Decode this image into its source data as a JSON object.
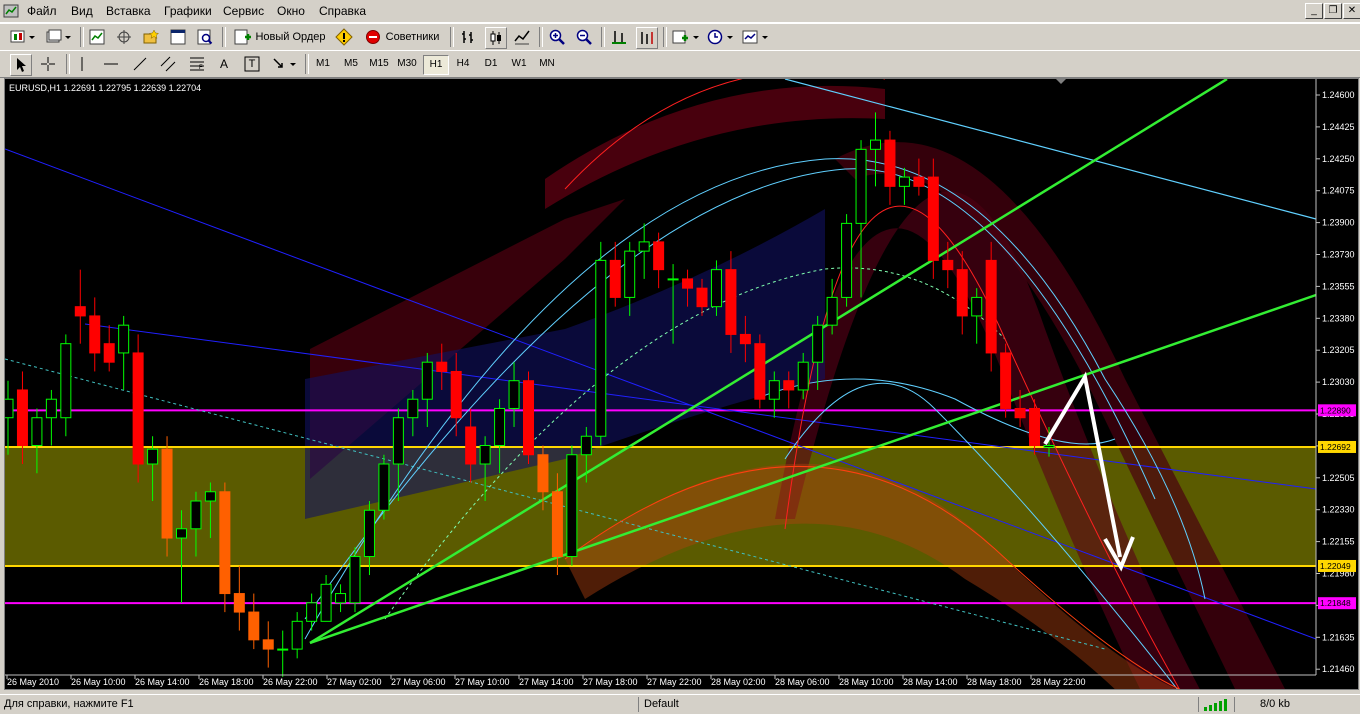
{
  "menu": [
    "Файл",
    "Вид",
    "Вставка",
    "Графики",
    "Сервис",
    "Окно",
    "Справка"
  ],
  "toolbar": {
    "new_order": "Новый Ордер",
    "advisors": "Советники",
    "labels": [
      "A",
      "T"
    ]
  },
  "timeframes": [
    {
      "label": "M1",
      "active": false
    },
    {
      "label": "M5",
      "active": false
    },
    {
      "label": "M15",
      "active": false
    },
    {
      "label": "M30",
      "active": false
    },
    {
      "label": "H1",
      "active": true
    },
    {
      "label": "H4",
      "active": false
    },
    {
      "label": "D1",
      "active": false
    },
    {
      "label": "W1",
      "active": false
    },
    {
      "label": "MN",
      "active": false
    }
  ],
  "chart": {
    "info": "EURUSD,H1  1.22691 1.22795 1.22639 1.22704",
    "price_axis": [
      "1.24600",
      "1.24425",
      "1.24250",
      "1.24075",
      "1.23900",
      "1.23730",
      "1.23555",
      "1.23380",
      "1.23205",
      "1.23030",
      "1.22855",
      "1.22680",
      "1.22505",
      "1.22330",
      "1.22155",
      "1.21980",
      "1.21805",
      "1.21635",
      "1.21460"
    ],
    "time_axis": [
      "26 May 2010",
      "26 May 10:00",
      "26 May 14:00",
      "26 May 18:00",
      "26 May 22:00",
      "27 May 02:00",
      "27 May 06:00",
      "27 May 10:00",
      "27 May 14:00",
      "27 May 18:00",
      "27 May 22:00",
      "28 May 02:00",
      "28 May 06:00",
      "28 May 10:00",
      "28 May 14:00",
      "28 May 18:00",
      "28 May 22:00"
    ],
    "levels": [
      {
        "price": 1.22692,
        "label": "1.22692",
        "color": "#ffd700"
      },
      {
        "price": 1.22049,
        "label": "1.22049",
        "color": "#ffd700"
      },
      {
        "price": 1.2289,
        "label": "1.22890",
        "color": "#ff00ff"
      },
      {
        "price": 1.21848,
        "label": "1.21848",
        "color": "#ff00ff"
      }
    ],
    "colors": {
      "bull": "#00ff00",
      "bear": "#ff0000",
      "bear_orange": "#ff6000",
      "grid": "#404040",
      "trend": "#33ee33",
      "zone": "#6b6b00"
    }
  },
  "chart_data": {
    "type": "candlestick",
    "symbol": "EURUSD",
    "timeframe": "H1",
    "ohlc_last": {
      "open": 1.22691,
      "high": 1.22795,
      "low": 1.22639,
      "close": 1.22704
    },
    "ylim": [
      1.2146,
      1.2468
    ],
    "candles": [
      [
        1.2285,
        1.2305,
        1.2265,
        1.2295
      ],
      [
        1.23,
        1.231,
        1.226,
        1.227
      ],
      [
        1.227,
        1.229,
        1.2255,
        1.2285
      ],
      [
        1.2285,
        1.23,
        1.227,
        1.2295
      ],
      [
        1.2285,
        1.233,
        1.2275,
        1.2325
      ],
      [
        1.2345,
        1.2365,
        1.2325,
        1.234
      ],
      [
        1.234,
        1.235,
        1.231,
        1.232
      ],
      [
        1.2325,
        1.2335,
        1.231,
        1.2315
      ],
      [
        1.232,
        1.234,
        1.23,
        1.2335
      ],
      [
        1.232,
        1.233,
        1.225,
        1.226
      ],
      [
        1.226,
        1.2275,
        1.224,
        1.2268
      ],
      [
        1.2268,
        1.2275,
        1.221,
        1.222
      ],
      [
        1.222,
        1.2235,
        1.2185,
        1.2225
      ],
      [
        1.2225,
        1.2245,
        1.221,
        1.224
      ],
      [
        1.224,
        1.225,
        1.222,
        1.2245
      ],
      [
        1.2245,
        1.225,
        1.218,
        1.219
      ],
      [
        1.219,
        1.2205,
        1.217,
        1.218
      ],
      [
        1.218,
        1.219,
        1.216,
        1.2165
      ],
      [
        1.2165,
        1.2175,
        1.215,
        1.216
      ],
      [
        1.216,
        1.217,
        1.2145,
        1.216
      ],
      [
        1.216,
        1.218,
        1.2155,
        1.2175
      ],
      [
        1.2175,
        1.219,
        1.217,
        1.2185
      ],
      [
        1.2175,
        1.22,
        1.2175,
        1.2195
      ],
      [
        1.2185,
        1.2195,
        1.218,
        1.219
      ],
      [
        1.2185,
        1.2215,
        1.218,
        1.221
      ],
      [
        1.221,
        1.224,
        1.22,
        1.2235
      ],
      [
        1.2235,
        1.2265,
        1.223,
        1.226
      ],
      [
        1.226,
        1.229,
        1.224,
        1.2285
      ],
      [
        1.2285,
        1.23,
        1.2275,
        1.2295
      ],
      [
        1.2295,
        1.232,
        1.228,
        1.2315
      ],
      [
        1.2315,
        1.2325,
        1.23,
        1.231
      ],
      [
        1.231,
        1.232,
        1.2275,
        1.2285
      ],
      [
        1.228,
        1.229,
        1.225,
        1.226
      ],
      [
        1.226,
        1.2275,
        1.224,
        1.227
      ],
      [
        1.227,
        1.2295,
        1.2255,
        1.229
      ],
      [
        1.229,
        1.2315,
        1.228,
        1.2305
      ],
      [
        1.2305,
        1.231,
        1.226,
        1.2265
      ],
      [
        1.2265,
        1.227,
        1.2235,
        1.2245
      ],
      [
        1.2245,
        1.2255,
        1.22,
        1.221
      ],
      [
        1.221,
        1.227,
        1.2205,
        1.2265
      ],
      [
        1.2265,
        1.228,
        1.225,
        1.2275
      ],
      [
        1.2275,
        1.238,
        1.227,
        1.237
      ],
      [
        1.237,
        1.238,
        1.2345,
        1.235
      ],
      [
        1.235,
        1.238,
        1.234,
        1.2375
      ],
      [
        1.2375,
        1.239,
        1.236,
        1.238
      ],
      [
        1.238,
        1.2385,
        1.2355,
        1.2365
      ],
      [
        1.236,
        1.2368,
        1.2325,
        1.236
      ],
      [
        1.236,
        1.2365,
        1.2345,
        1.2355
      ],
      [
        1.2355,
        1.236,
        1.234,
        1.2345
      ],
      [
        1.2345,
        1.237,
        1.234,
        1.2365
      ],
      [
        1.2365,
        1.2375,
        1.232,
        1.233
      ],
      [
        1.233,
        1.234,
        1.2315,
        1.2325
      ],
      [
        1.2325,
        1.233,
        1.229,
        1.2295
      ],
      [
        1.2295,
        1.231,
        1.2285,
        1.2305
      ],
      [
        1.2305,
        1.231,
        1.229,
        1.23
      ],
      [
        1.23,
        1.232,
        1.2295,
        1.2315
      ],
      [
        1.2315,
        1.234,
        1.23,
        1.2335
      ],
      [
        1.2335,
        1.236,
        1.233,
        1.235
      ],
      [
        1.235,
        1.2395,
        1.2345,
        1.239
      ],
      [
        1.239,
        1.2435,
        1.235,
        1.243
      ],
      [
        1.243,
        1.245,
        1.241,
        1.2435
      ],
      [
        1.2435,
        1.244,
        1.24,
        1.241
      ],
      [
        1.241,
        1.242,
        1.24,
        1.2415
      ],
      [
        1.2415,
        1.2425,
        1.2405,
        1.241
      ],
      [
        1.2415,
        1.2425,
        1.236,
        1.237
      ],
      [
        1.237,
        1.238,
        1.2355,
        1.2365
      ],
      [
        1.2365,
        1.2375,
        1.233,
        1.234
      ],
      [
        1.234,
        1.2355,
        1.2325,
        1.235
      ],
      [
        1.237,
        1.238,
        1.231,
        1.232
      ],
      [
        1.232,
        1.2325,
        1.2285,
        1.229
      ],
      [
        1.229,
        1.23,
        1.228,
        1.2285
      ],
      [
        1.229,
        1.2295,
        1.2265,
        1.227
      ],
      [
        1.2269,
        1.228,
        1.2264,
        1.227
      ]
    ]
  },
  "status": {
    "help": "Для справки, нажмите F1",
    "profile": "Default",
    "traffic": "8/0 kb"
  }
}
